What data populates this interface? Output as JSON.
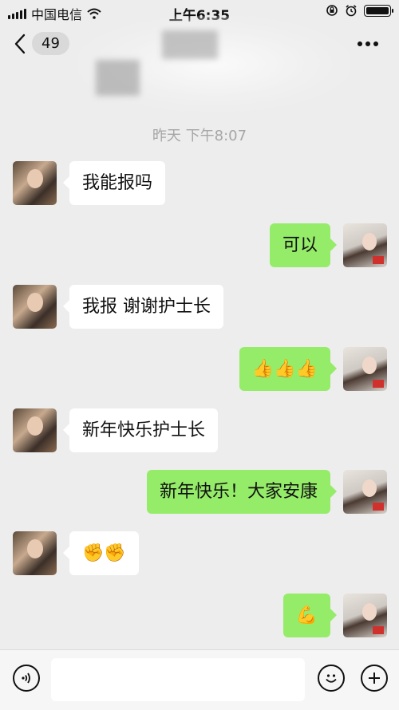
{
  "status_bar": {
    "carrier": "中国电信",
    "time": "上午6:35"
  },
  "nav": {
    "unread_count": "49"
  },
  "chat": {
    "timestamp": "昨天 下午8:07",
    "messages": [
      {
        "side": "received",
        "text": "我能报吗"
      },
      {
        "side": "sent",
        "text": "可以"
      },
      {
        "side": "received",
        "text": "我报  谢谢护士长"
      },
      {
        "side": "sent",
        "text": "👍👍👍"
      },
      {
        "side": "received",
        "text": "新年快乐护士长"
      },
      {
        "side": "sent",
        "text": "新年快乐！大家安康"
      },
      {
        "side": "received",
        "text": "✊✊"
      },
      {
        "side": "sent",
        "text": "💪"
      }
    ]
  },
  "icons": {
    "back": "chevron-left-icon",
    "more": "more-dots-icon",
    "voice": "voice-icon",
    "emoji": "emoji-icon",
    "plus": "plus-icon"
  },
  "colors": {
    "background": "#ededed",
    "sent_bubble": "#95ec69",
    "received_bubble": "#ffffff"
  }
}
